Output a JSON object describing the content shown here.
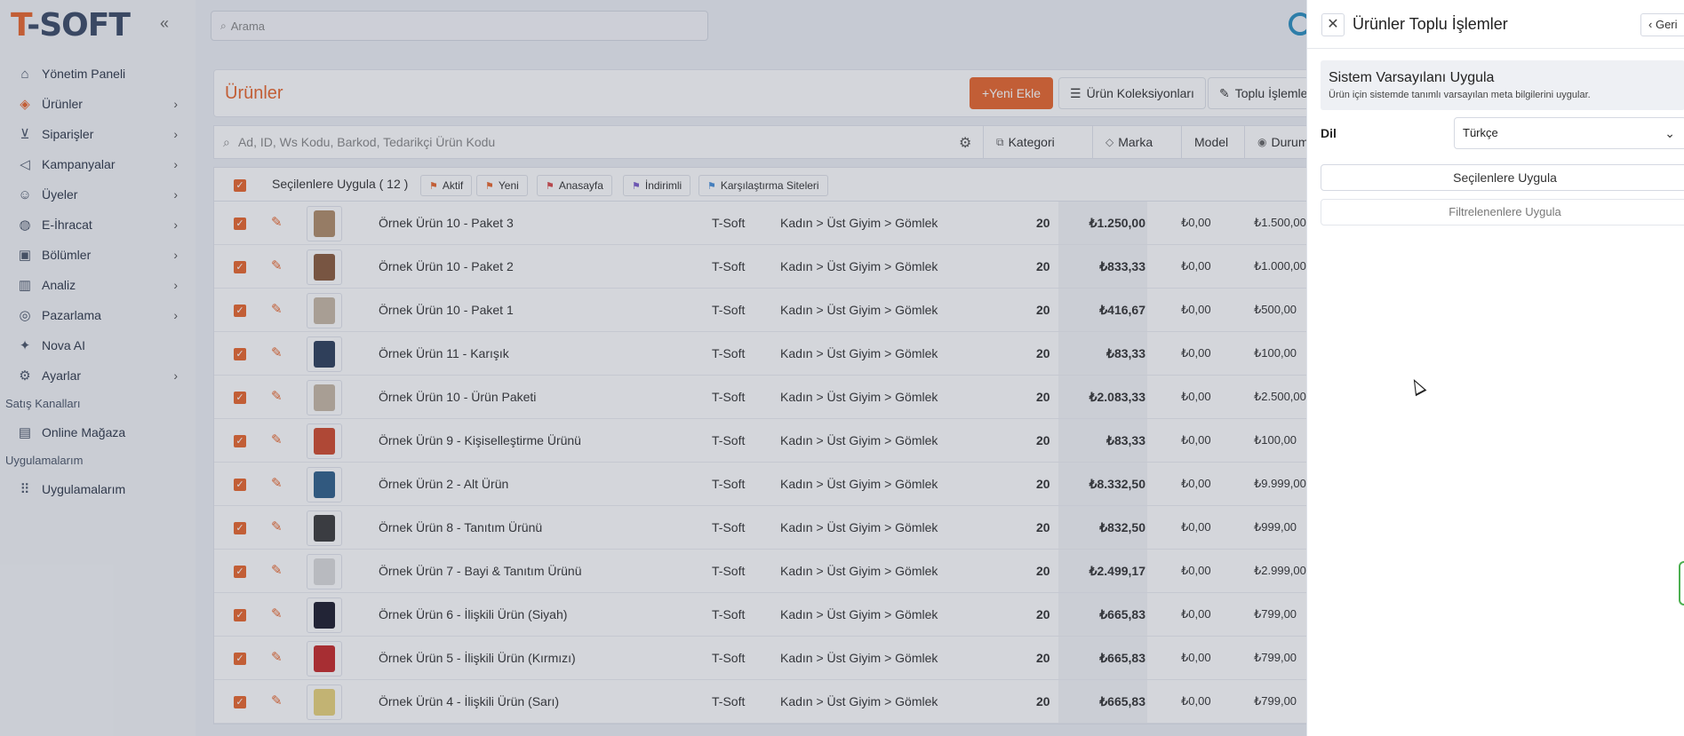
{
  "brand": {
    "logo_first": "T",
    "logo_rest": "-SOFT"
  },
  "sidebar": {
    "items": [
      {
        "label": "Yönetim Paneli",
        "icon": "home-icon",
        "chevron": false
      },
      {
        "label": "Ürünler",
        "icon": "tag-icon",
        "chevron": true
      },
      {
        "label": "Siparişler",
        "icon": "cart-icon",
        "chevron": true
      },
      {
        "label": "Kampanyalar",
        "icon": "megaphone-icon",
        "chevron": true
      },
      {
        "label": "Üyeler",
        "icon": "users-icon",
        "chevron": true
      },
      {
        "label": "E-İhracat",
        "icon": "globe-icon",
        "chevron": true
      },
      {
        "label": "Bölümler",
        "icon": "layout-icon",
        "chevron": true
      },
      {
        "label": "Analiz",
        "icon": "chart-icon",
        "chevron": true
      },
      {
        "label": "Pazarlama",
        "icon": "target-icon",
        "chevron": true
      },
      {
        "label": "Nova AI",
        "icon": "sparkle-icon",
        "chevron": false
      },
      {
        "label": "Ayarlar",
        "icon": "gear-icon",
        "chevron": true
      }
    ],
    "section_sales": "Satış Kanalları",
    "online_store": "Online Mağaza",
    "section_apps": "Uygulamalarım",
    "apps": "Uygulamalarım"
  },
  "topbar": {
    "search_placeholder": "Arama"
  },
  "main": {
    "title": "Ürünler",
    "btn_new": "+Yeni Ekle",
    "btn_collections": "Ürün Koleksiyonları",
    "btn_bulk": "Toplu İşlemler",
    "filter_placeholder": "Ad, ID, Ws Kodu, Barkod, Tedarikçi Ürün Kodu",
    "filter_buttons": [
      "Kategori",
      "Marka",
      "Model",
      "Durum"
    ],
    "apply_selected": "Seçilenlere Uygula ( 12 )",
    "tags": [
      {
        "label": "Aktif",
        "color": "#e8662c"
      },
      {
        "label": "Yeni",
        "color": "#e8662c"
      },
      {
        "label": "Anasayfa",
        "color": "#d94a4a"
      },
      {
        "label": "İndirimli",
        "color": "#7a5cc9"
      },
      {
        "label": "Karşılaştırma Siteleri",
        "color": "#4a90d9"
      }
    ],
    "rows": [
      {
        "name": "Örnek Ürün 10 - Paket 3",
        "brand": "T-Soft",
        "category": "Kadın > Üst Giyim > Gömlek",
        "stock": "20",
        "price": "₺1.250,00",
        "discount": "₺0,00",
        "sale": "₺1.500,00",
        "thumb": "#b08c68"
      },
      {
        "name": "Örnek Ürün 10 - Paket 2",
        "brand": "T-Soft",
        "category": "Kadın > Üst Giyim > Gömlek",
        "stock": "20",
        "price": "₺833,33",
        "discount": "₺0,00",
        "sale": "₺1.000,00",
        "thumb": "#8a5a3c"
      },
      {
        "name": "Örnek Ürün 10 - Paket 1",
        "brand": "T-Soft",
        "category": "Kadın > Üst Giyim > Gömlek",
        "stock": "20",
        "price": "₺416,67",
        "discount": "₺0,00",
        "sale": "₺500,00",
        "thumb": "#c7b8a4"
      },
      {
        "name": "Örnek Ürün 11 - Karışık",
        "brand": "T-Soft",
        "category": "Kadın > Üst Giyim > Gömlek",
        "stock": "20",
        "price": "₺83,33",
        "discount": "₺0,00",
        "sale": "₺100,00",
        "thumb": "#2c3e5a"
      },
      {
        "name": "Örnek Ürün 10 - Ürün Paketi",
        "brand": "T-Soft",
        "category": "Kadın > Üst Giyim > Gömlek",
        "stock": "20",
        "price": "₺2.083,33",
        "discount": "₺0,00",
        "sale": "₺2.500,00",
        "thumb": "#c7b8a4"
      },
      {
        "name": "Örnek Ürün 9 - Kişiselleştirme Ürünü",
        "brand": "T-Soft",
        "category": "Kadın > Üst Giyim > Gömlek",
        "stock": "20",
        "price": "₺83,33",
        "discount": "₺0,00",
        "sale": "₺100,00",
        "thumb": "#d04a2c"
      },
      {
        "name": "Örnek Ürün 2 - Alt Ürün",
        "brand": "T-Soft",
        "category": "Kadın > Üst Giyim > Gömlek",
        "stock": "20",
        "price": "₺8.332,50",
        "discount": "₺0,00",
        "sale": "₺9.999,00",
        "thumb": "#2f5f8a"
      },
      {
        "name": "Örnek Ürün 8 - Tanıtım Ürünü",
        "brand": "T-Soft",
        "category": "Kadın > Üst Giyim > Gömlek",
        "stock": "20",
        "price": "₺832,50",
        "discount": "₺0,00",
        "sale": "₺999,00",
        "thumb": "#3a3a3a"
      },
      {
        "name": "Örnek Ürün 7 - Bayi & Tanıtım Ürünü",
        "brand": "T-Soft",
        "category": "Kadın > Üst Giyim > Gömlek",
        "stock": "20",
        "price": "₺2.499,17",
        "discount": "₺0,00",
        "sale": "₺2.999,00",
        "thumb": "#dcdcdc"
      },
      {
        "name": "Örnek Ürün 6 - İlişkili Ürün (Siyah)",
        "brand": "T-Soft",
        "category": "Kadın > Üst Giyim > Gömlek",
        "stock": "20",
        "price": "₺665,83",
        "discount": "₺0,00",
        "sale": "₺799,00",
        "thumb": "#1c1c2c"
      },
      {
        "name": "Örnek Ürün 5 - İlişkili Ürün (Kırmızı)",
        "brand": "T-Soft",
        "category": "Kadın > Üst Giyim > Gömlek",
        "stock": "20",
        "price": "₺665,83",
        "discount": "₺0,00",
        "sale": "₺799,00",
        "thumb": "#c62828"
      },
      {
        "name": "Örnek Ürün 4 - İlişkili Ürün (Sarı)",
        "brand": "T-Soft",
        "category": "Kadın > Üst Giyim > Gömlek",
        "stock": "20",
        "price": "₺665,83",
        "discount": "₺0,00",
        "sale": "₺799,00",
        "thumb": "#e8d27a"
      }
    ]
  },
  "panel": {
    "title": "Ürünler Toplu İşlemler",
    "back": "Geri",
    "section_title": "Sistem Varsayılanı Uygula",
    "section_desc": "Ürün için sistemde tanımlı varsayılan meta bilgilerini uygular.",
    "lang_label": "Dil",
    "lang_value": "Türkçe",
    "apply_selected": "Seçilenlere Uygula",
    "apply_filtered": "Filtrelenenlere Uygula"
  },
  "colors": {
    "accent": "#e8662c"
  }
}
